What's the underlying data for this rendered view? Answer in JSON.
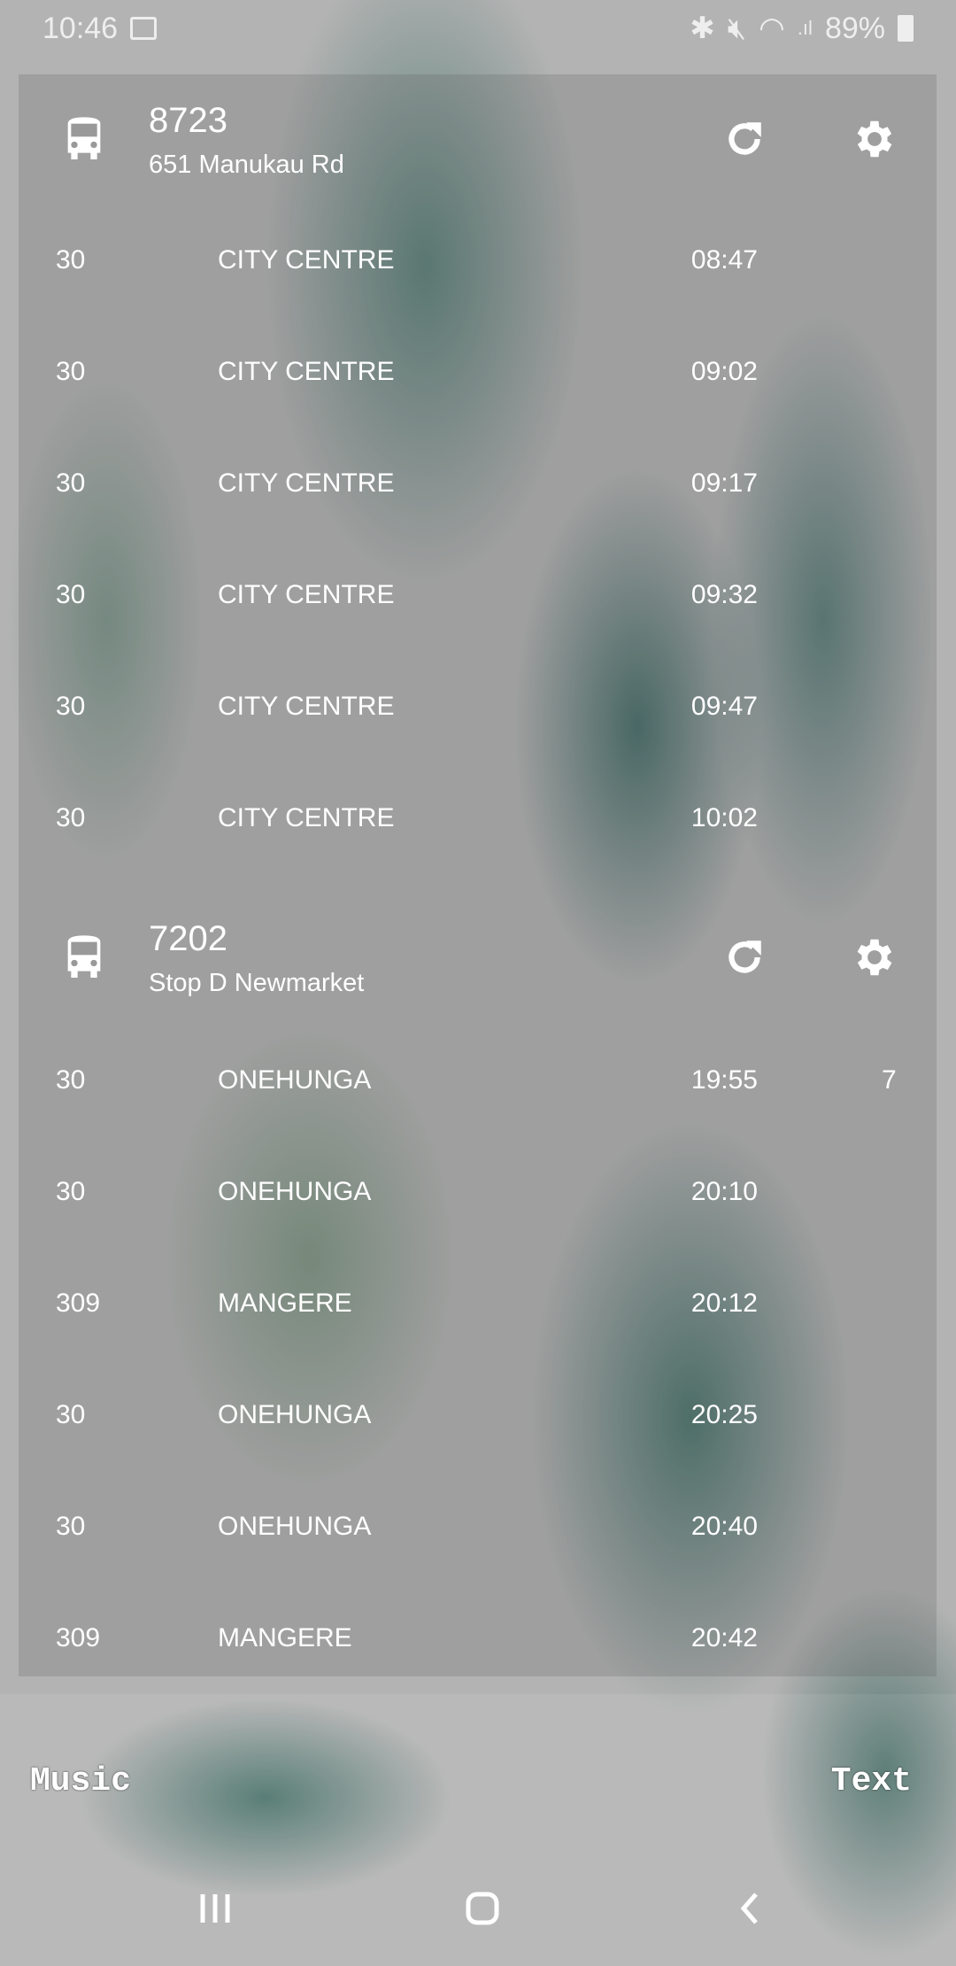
{
  "status_bar": {
    "time": "10:46",
    "battery": "89%"
  },
  "widgets": [
    {
      "stop_number": "8723",
      "stop_name": "651 Manukau Rd",
      "rows": [
        {
          "route": "30",
          "destination": "CITY CENTRE",
          "time": "08:47"
        },
        {
          "route": "30",
          "destination": "CITY CENTRE",
          "time": "09:02"
        },
        {
          "route": "30",
          "destination": "CITY CENTRE",
          "time": "09:17"
        },
        {
          "route": "30",
          "destination": "CITY CENTRE",
          "time": "09:32"
        },
        {
          "route": "30",
          "destination": "CITY CENTRE",
          "time": "09:47"
        },
        {
          "route": "30",
          "destination": "CITY CENTRE",
          "time": "10:02"
        }
      ]
    },
    {
      "stop_number": "7202",
      "stop_name": "Stop D Newmarket",
      "rows": [
        {
          "route": "30",
          "destination": "ONEHUNGA",
          "time": "19:55",
          "minutes": "7"
        },
        {
          "route": "30",
          "destination": "ONEHUNGA",
          "time": "20:10"
        },
        {
          "route": "309",
          "destination": "MANGERE",
          "time": "20:12"
        },
        {
          "route": "30",
          "destination": "ONEHUNGA",
          "time": "20:25"
        },
        {
          "route": "30",
          "destination": "ONEHUNGA",
          "time": "20:40"
        },
        {
          "route": "309",
          "destination": "MANGERE",
          "time": "20:42"
        }
      ]
    }
  ],
  "shortcuts": {
    "left": "Music",
    "right": "Text"
  }
}
